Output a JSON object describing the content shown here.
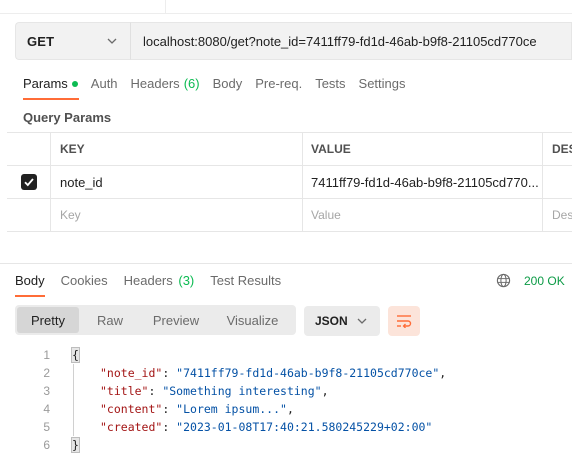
{
  "request": {
    "method": "GET",
    "url": "localhost:8080/get?note_id=7411ff79-fd1d-46ab-b9f8-21105cd770ce"
  },
  "request_tabs": [
    {
      "label": "Params",
      "active": true,
      "dot": true
    },
    {
      "label": "Auth"
    },
    {
      "label": "Headers",
      "count": "(6)"
    },
    {
      "label": "Body"
    },
    {
      "label": "Pre-req."
    },
    {
      "label": "Tests"
    },
    {
      "label": "Settings"
    }
  ],
  "query_params": {
    "title": "Query Params",
    "headers": [
      "KEY",
      "VALUE",
      "DESC"
    ],
    "row": {
      "key": "note_id",
      "value": "7411ff79-fd1d-46ab-b9f8-21105cd770..."
    },
    "placeholders": {
      "key": "Key",
      "value": "Value",
      "desc": "Desc"
    }
  },
  "response_tabs": [
    {
      "label": "Body",
      "active": true
    },
    {
      "label": "Cookies"
    },
    {
      "label": "Headers",
      "count": "(3)"
    },
    {
      "label": "Test Results"
    }
  ],
  "status": "200 OK",
  "view_modes": [
    "Pretty",
    "Raw",
    "Preview",
    "Visualize"
  ],
  "format": "JSON",
  "code": {
    "line_numbers": [
      "1",
      "2",
      "3",
      "4",
      "5",
      "6"
    ],
    "open": "{",
    "close": "}",
    "fields": [
      {
        "key": "\"note_id\"",
        "value": "\"7411ff79-fd1d-46ab-b9f8-21105cd770ce\"",
        "trail": ","
      },
      {
        "key": "\"title\"",
        "value": "\"Something interesting\"",
        "trail": ","
      },
      {
        "key": "\"content\"",
        "value": "\"Lorem ipsum...\"",
        "trail": ","
      },
      {
        "key": "\"created\"",
        "value": "\"2023-01-08T17:40:21.580245229+02:00\"",
        "trail": ""
      }
    ]
  },
  "colors": {
    "accent": "#ff6c37",
    "success": "#0cbb52"
  }
}
